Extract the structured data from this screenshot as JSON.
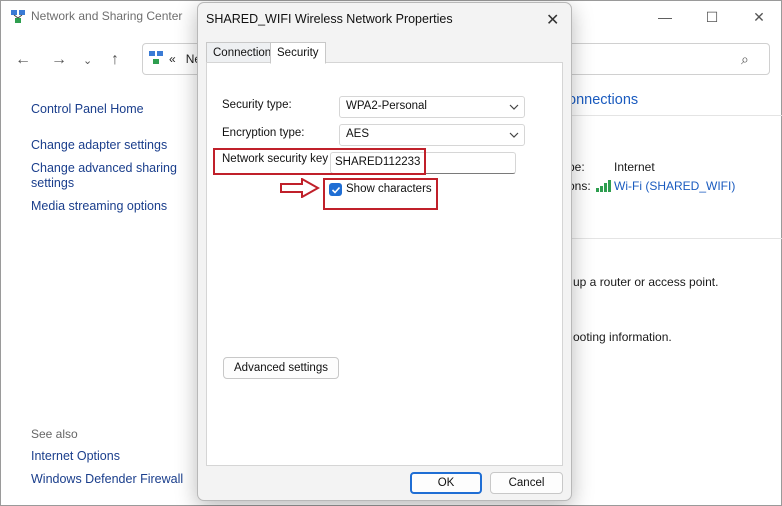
{
  "background_window": {
    "title": "Network and Sharing Center",
    "address_chevron": "«",
    "address_text": "Ne",
    "icons": [
      "network-icon",
      "back-icon",
      "forward-icon",
      "dropdown-icon",
      "up-icon",
      "search-icon",
      "minimize-icon",
      "maximize-icon",
      "close-icon"
    ],
    "left_links": [
      "Control Panel Home",
      "Change adapter settings",
      "Change advanced sharing settings",
      "Media streaming options"
    ],
    "see_also_heading": "See also",
    "see_also_links": [
      "Internet Options",
      "Windows Defender Firewall"
    ],
    "right_heading_fragment": "onnections",
    "access_type_label_fragment": "pe:",
    "access_type_value": "Internet",
    "connections_label_fragment": "ons:",
    "connection_link": "Wi-Fi (SHARED_WIFI)",
    "router_text_fragment": "up a router or access point.",
    "troubleshoot_text_fragment": "ooting information."
  },
  "dialog": {
    "title": "SHARED_WIFI Wireless Network Properties",
    "tabs": [
      {
        "label": "Connection",
        "active": false
      },
      {
        "label": "Security",
        "active": true
      }
    ],
    "security_type_label": "Security type:",
    "security_type_value": "WPA2-Personal",
    "encryption_type_label": "Encryption type:",
    "encryption_type_value": "AES",
    "network_key_label": "Network security key",
    "network_key_value": "SHARED112233",
    "show_characters_label": "Show characters",
    "show_characters_checked": true,
    "advanced_button": "Advanced settings",
    "ok_button": "OK",
    "cancel_button": "Cancel"
  },
  "colors": {
    "link": "#1a3e8c",
    "accent": "#1f6ed4",
    "annotation_red": "#c0202a"
  }
}
